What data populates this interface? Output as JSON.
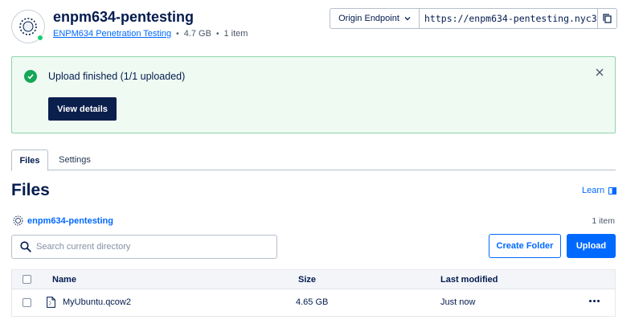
{
  "header": {
    "bucket_name": "enpm634-pentesting",
    "project_name": "ENPM634 Penetration Testing",
    "size": "4.7 GB",
    "item_count": "1 item",
    "endpoint_select": "Origin Endpoint",
    "endpoint_url": "https://enpm634-pentesting.nyc3",
    "status_color": "#15cd72"
  },
  "alert": {
    "message": "Upload finished (1/1 uploaded)",
    "button_label": "View details"
  },
  "tabs": [
    {
      "label": "Files",
      "active": true
    },
    {
      "label": "Settings",
      "active": false
    }
  ],
  "files": {
    "title": "Files",
    "learn_label": "Learn",
    "breadcrumb": "enpm634-pentesting",
    "count": "1 item",
    "search_placeholder": "Search current directory",
    "create_folder_label": "Create Folder",
    "upload_label": "Upload"
  },
  "table": {
    "columns": [
      "Name",
      "Size",
      "Last modified"
    ],
    "rows": [
      {
        "name": "MyUbuntu.qcow2",
        "size": "4.65 GB",
        "modified": "Just now"
      }
    ]
  },
  "colors": {
    "accent": "#0069ff",
    "success": "#15a657",
    "navy": "#031b4e"
  }
}
